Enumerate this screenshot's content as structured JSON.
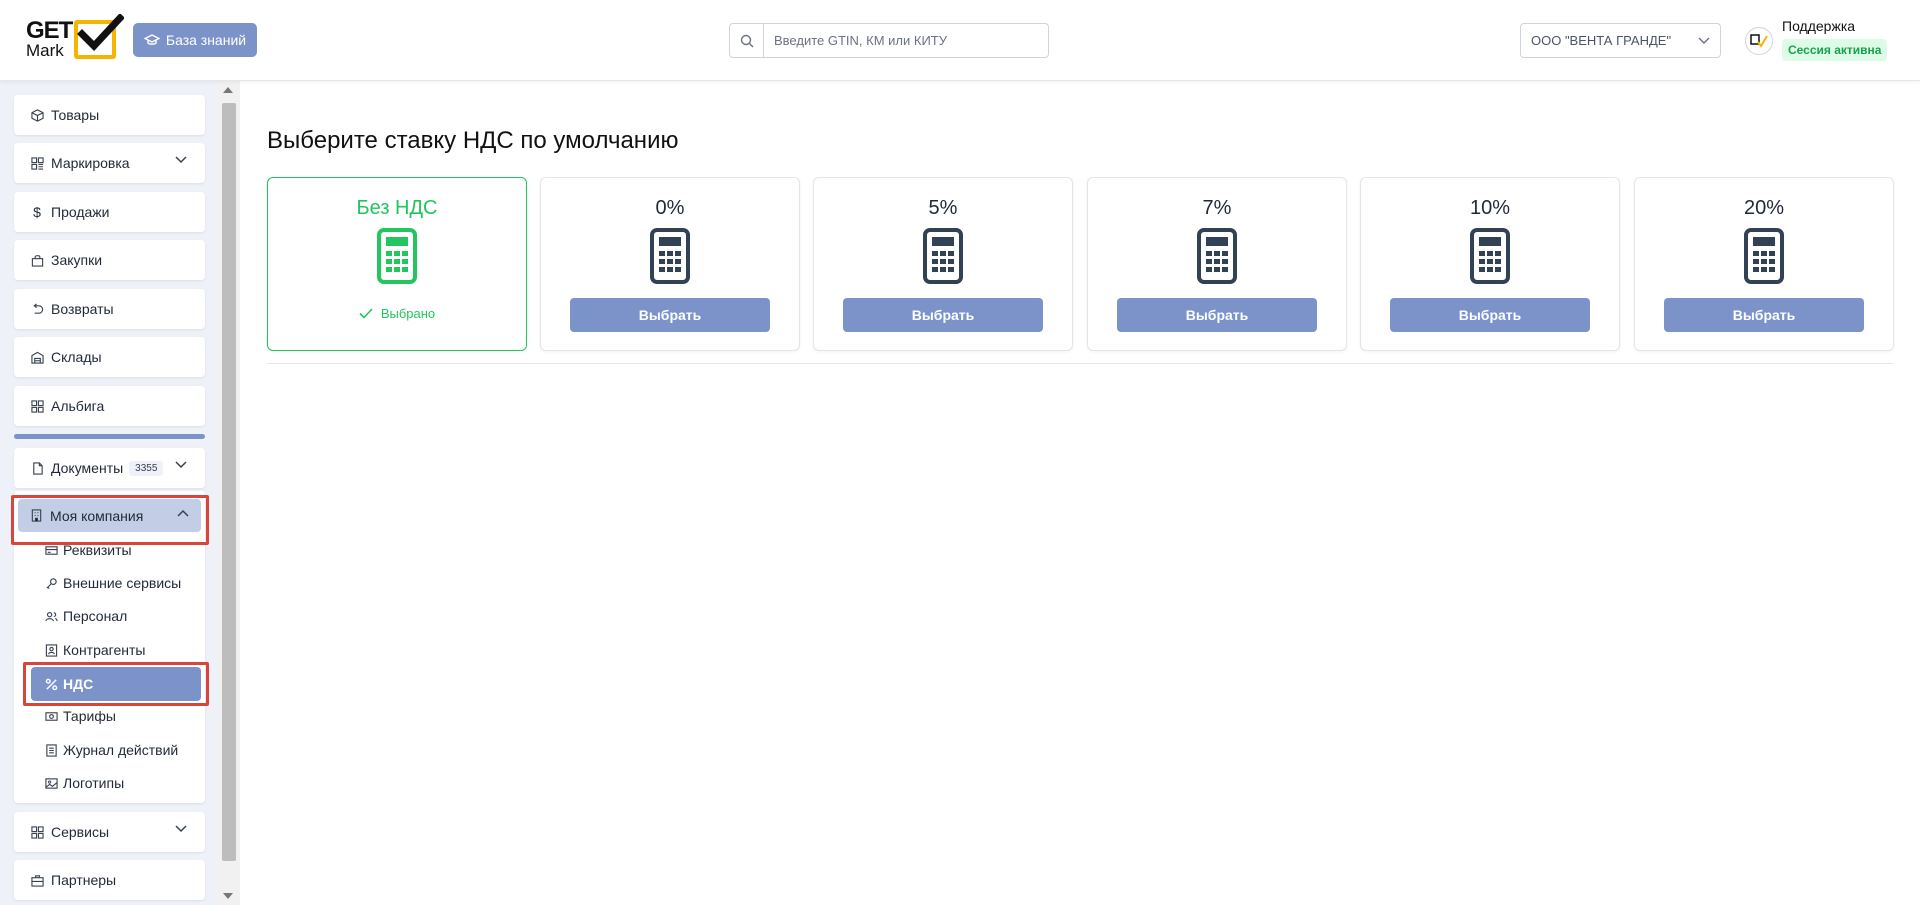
{
  "header": {
    "logo": {
      "line1": "GET",
      "line2": "Mark"
    },
    "knowledge_base_label": "База знаний",
    "search": {
      "placeholder": "Введите GTIN, КМ или КИТУ",
      "value": ""
    },
    "company_select": "ООО \"ВЕНТА ГРАНДЕ\"",
    "support_label": "Поддержка",
    "session_status": "Сессия активна",
    "accent_color": "#7b93c9"
  },
  "sidebar": {
    "items": [
      {
        "label": "Товары",
        "icon": "box-icon"
      },
      {
        "label": "Маркировка",
        "icon": "grid-icon",
        "expandable": true
      },
      {
        "label": "Продажи",
        "icon": "dollar-icon"
      },
      {
        "label": "Закупки",
        "icon": "bag-icon"
      },
      {
        "label": "Возвраты",
        "icon": "undo-icon"
      },
      {
        "label": "Склады",
        "icon": "warehouse-icon"
      },
      {
        "label": "Альбига",
        "icon": "grid-icon"
      }
    ],
    "documents": {
      "label": "Документы",
      "count": "3355"
    },
    "company": {
      "label": "Моя компания",
      "subitems": [
        {
          "label": "Реквизиты",
          "icon": "card-icon"
        },
        {
          "label": "Внешние сервисы",
          "icon": "key-icon"
        },
        {
          "label": "Персонал",
          "icon": "users-icon"
        },
        {
          "label": "Контрагенты",
          "icon": "contact-icon"
        },
        {
          "label": "НДС",
          "icon": "percent-icon",
          "active": true
        },
        {
          "label": "Тарифы",
          "icon": "cash-icon"
        },
        {
          "label": "Журнал действий",
          "icon": "journal-icon"
        },
        {
          "label": "Логотипы",
          "icon": "image-icon"
        }
      ]
    },
    "services": {
      "label": "Сервисы"
    },
    "partners": {
      "label": "Партнеры"
    }
  },
  "main": {
    "title": "Выберите ставку НДС по умолчанию",
    "selected_color": "#22c55e",
    "rates": [
      {
        "label": "Без НДС",
        "selected": true,
        "status": "Выбрано"
      },
      {
        "label": "0%",
        "selected": false,
        "button": "Выбрать"
      },
      {
        "label": "5%",
        "selected": false,
        "button": "Выбрать"
      },
      {
        "label": "7%",
        "selected": false,
        "button": "Выбрать"
      },
      {
        "label": "10%",
        "selected": false,
        "button": "Выбрать"
      },
      {
        "label": "20%",
        "selected": false,
        "button": "Выбрать"
      }
    ]
  }
}
